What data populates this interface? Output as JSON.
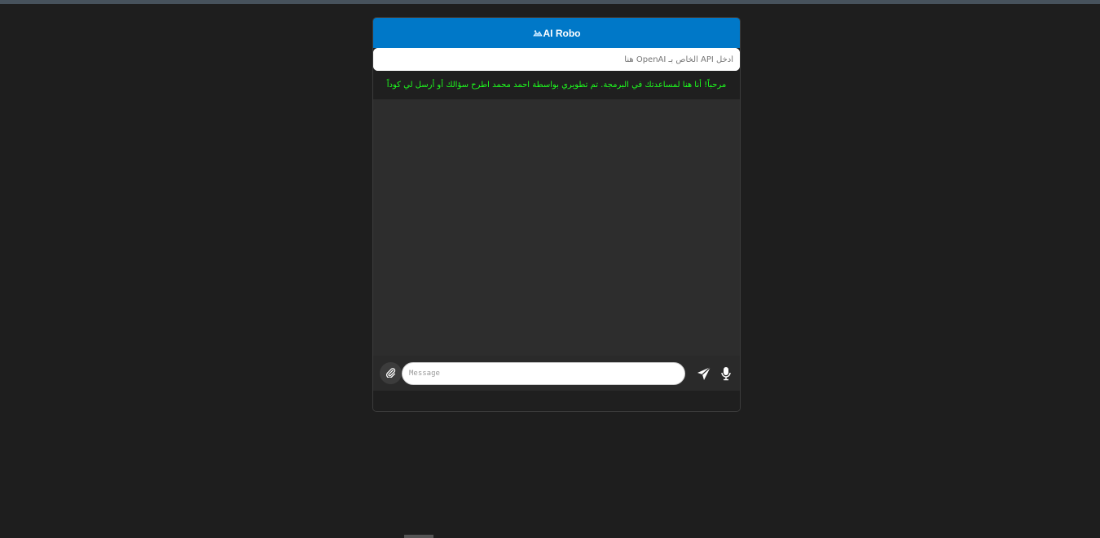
{
  "header": {
    "title": "AI Robo",
    "logo_icon": "broken-image-icon"
  },
  "api_key": {
    "placeholder": "أدخل API الخاص بـ OpenAI هنا"
  },
  "welcome": {
    "text": "مرحباً! أنا هنا لمساعدتك في البرمجة. تم تطويري بواسطة احمد محمد اطرح سؤالك أو أرسل لي كوداً"
  },
  "composer": {
    "message_placeholder": "Message",
    "attach_icon": "paperclip-icon",
    "send_icon": "send-icon",
    "mic_icon": "microphone-icon"
  },
  "colors": {
    "header_bg": "#0078c8",
    "welcome_text": "#1eff1e",
    "page_bg": "#1e1e1e",
    "messages_bg": "#2d2d2d"
  }
}
